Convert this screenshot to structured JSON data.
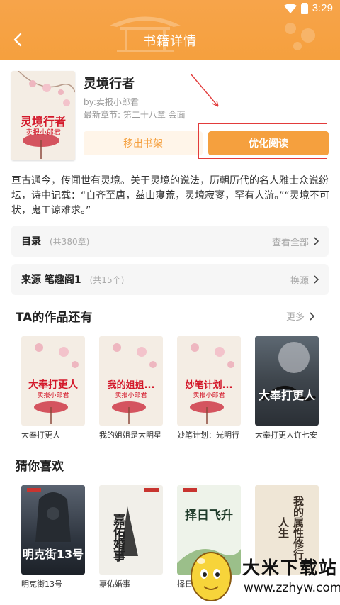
{
  "status_bar": {
    "time": "3:29"
  },
  "header": {
    "title": "书籍详情",
    "back_icon": "chevron-left-icon"
  },
  "book": {
    "name": "灵境行者",
    "author": "by:卖报小郎君",
    "latest": "最新章节: 第二十八章 会面",
    "cover_title": "灵境行者",
    "cover_author": "卖报小郎君",
    "remove_label": "移出书架",
    "read_label": "优化阅读"
  },
  "intro": "亘古通今，传闻世有灵境。关于灵境的说法，历朝历代的名人雅士众说纷坛，诗中记载：“自齐至唐，兹山寖荒，灵境寂寥，罕有人游。”“灵境不可状，鬼工谅难求。”",
  "toc": {
    "label": "目录",
    "count": "(共380章)",
    "action": "查看全部"
  },
  "source": {
    "label": "来源 笔趣阁1",
    "count": "(共15个)",
    "action": "换源"
  },
  "author_works": {
    "title": "TA的作品还有",
    "more": "更多",
    "items": [
      {
        "caption": "大奉打更人",
        "cover_title": "大奉打更人",
        "cover_author": "卖报小郎君"
      },
      {
        "caption": "我的姐姐是大明星",
        "cover_title": "我的姐姐...",
        "cover_author": "卖报小郎君"
      },
      {
        "caption": "妙笔计划：光明行",
        "cover_title": "妙笔计划...",
        "cover_author": "卖报小郎君"
      },
      {
        "caption": "大奉打更人许七安",
        "cover_title": "大奉打更人",
        "cover_author": ""
      }
    ]
  },
  "recommend": {
    "title": "猜你喜欢",
    "items": [
      {
        "caption": "明克街13号",
        "cover_title": "明克街13号"
      },
      {
        "caption": "嘉佑婚事",
        "cover_title": "嘉佑婚事"
      },
      {
        "caption": "择日飞升",
        "cover_title": "择日飞升"
      },
      {
        "caption": "",
        "cover_title": "我的属性修行人生"
      }
    ]
  },
  "watermark": {
    "name": "大米下载站",
    "url": "www.zzhyw.com"
  },
  "colors": {
    "accent": "#f5a03e",
    "annotation": "#e23b3b",
    "cover_red": "#d3182a"
  }
}
